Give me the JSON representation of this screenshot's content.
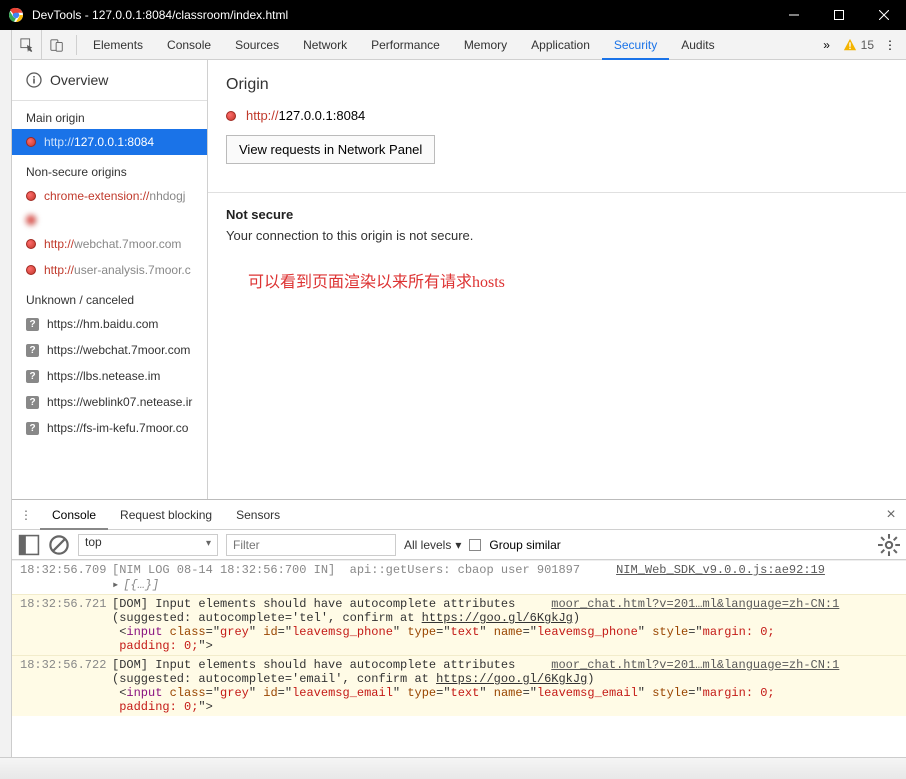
{
  "window": {
    "title": "DevTools - 127.0.0.1:8084/classroom/index.html"
  },
  "toolbar": {
    "tabs": [
      "Elements",
      "Console",
      "Sources",
      "Network",
      "Performance",
      "Memory",
      "Application",
      "Security",
      "Audits"
    ],
    "active": "Security",
    "warn_count": "15"
  },
  "sidebar": {
    "overview": "Overview",
    "main_origin_head": "Main origin",
    "main_origin": {
      "scheme": "http://",
      "host": "127.0.0.1:8084"
    },
    "nonsecure_head": "Non-secure origins",
    "nonsecure": [
      {
        "scheme": "chrome-extension://",
        "host": "nhdogj",
        "blur": false
      },
      {
        "scheme": "",
        "host": "",
        "blur": true
      },
      {
        "scheme": "http://",
        "host": "webchat.7moor.com",
        "blur": false
      },
      {
        "scheme": "http://",
        "host": "user-analysis.7moor.c",
        "blur": false
      }
    ],
    "unknown_head": "Unknown / canceled",
    "unknown": [
      "https://hm.baidu.com",
      "https://webchat.7moor.com",
      "https://lbs.netease.im",
      "https://weblink07.netease.ir",
      "https://fs-im-kefu.7moor.co"
    ]
  },
  "content": {
    "h_origin": "Origin",
    "origin_scheme": "http://",
    "origin_host": "127.0.0.1:8084",
    "view_button": "View requests in Network Panel",
    "not_secure": "Not secure",
    "desc": "Your connection to this origin is not secure.",
    "annotation": "可以看到页面渲染以来所有请求hosts"
  },
  "drawer": {
    "tabs": [
      "Console",
      "Request blocking",
      "Sensors"
    ],
    "active": "Console",
    "context": "top",
    "filter_placeholder": "Filter",
    "levels": "All levels",
    "group": "Group similar"
  },
  "console": {
    "rows": [
      {
        "ts": "18:32:56.709",
        "text_prefix": "[NIM LOG 08-14 18:32:56:700 IN]  api::getUsers: cbaop user 901897",
        "src": "NIM_Web_SDK_v9.0.0.js:ae92:19",
        "expand": "[{…}]",
        "warm": false
      },
      {
        "ts": "18:32:56.721",
        "line1": "[DOM] Input elements should have autocomplete attributes",
        "src": "moor_chat.html?v=201…ml&language=zh-CN:1",
        "line2_a": "(suggested: autocomplete='tel', confirm at ",
        "line2_link": "https://goo.gl/6KgkJg",
        "line2_b": ")",
        "code_id": "leavemsg_phone",
        "code_name": "leavemsg_phone",
        "warm": true
      },
      {
        "ts": "18:32:56.722",
        "line1": "[DOM] Input elements should have autocomplete attributes",
        "src": "moor_chat.html?v=201…ml&language=zh-CN:1",
        "line2_a": "(suggested: autocomplete='email', confirm at ",
        "line2_link": "https://goo.gl/6KgkJg",
        "line2_b": ")",
        "code_id": "leavemsg_email",
        "code_name": "leavemsg_email",
        "warm": true
      }
    ]
  }
}
